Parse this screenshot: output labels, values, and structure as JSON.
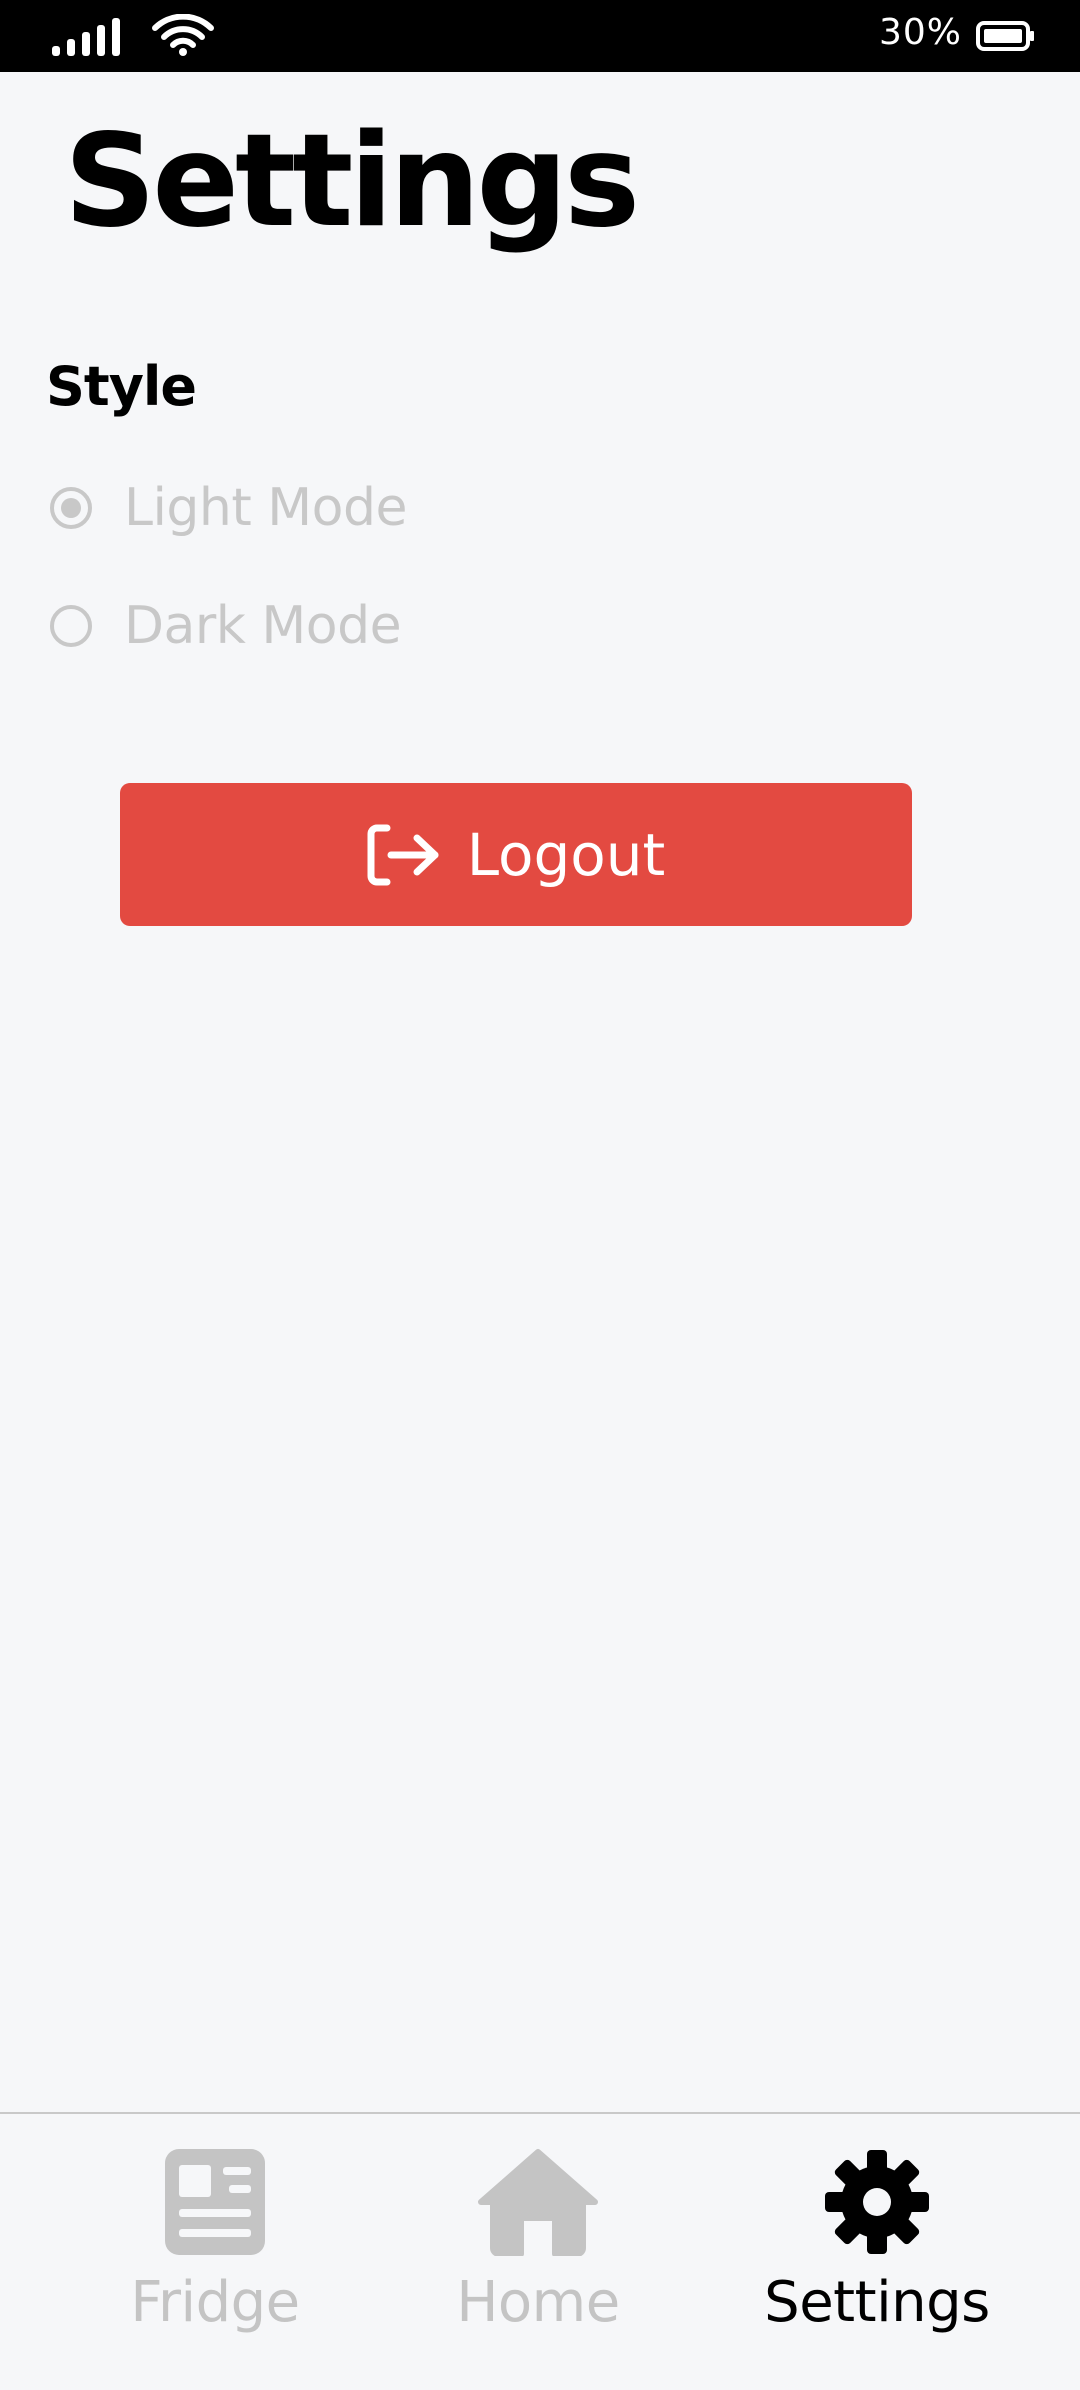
{
  "status_bar": {
    "battery_percent": "30%",
    "signal_icon": "signal-bars-icon",
    "wifi_icon": "wifi-icon",
    "battery_icon": "battery-icon"
  },
  "page": {
    "title": "Settings"
  },
  "style_section": {
    "label": "Style",
    "options": [
      {
        "label": "Light Mode",
        "selected": true
      },
      {
        "label": "Dark Mode",
        "selected": false
      }
    ]
  },
  "logout": {
    "label": "Logout",
    "icon": "logout-icon",
    "color": "#e34a41"
  },
  "bottom_nav": {
    "items": [
      {
        "label": "Fridge",
        "icon": "fridge-list-icon",
        "active": false
      },
      {
        "label": "Home",
        "icon": "home-icon",
        "active": false
      },
      {
        "label": "Settings",
        "icon": "gear-icon",
        "active": true
      }
    ]
  },
  "colors": {
    "background": "#f6f7f9",
    "inactive": "#c4c4c4",
    "active": "#000000",
    "accent": "#e34a41"
  }
}
